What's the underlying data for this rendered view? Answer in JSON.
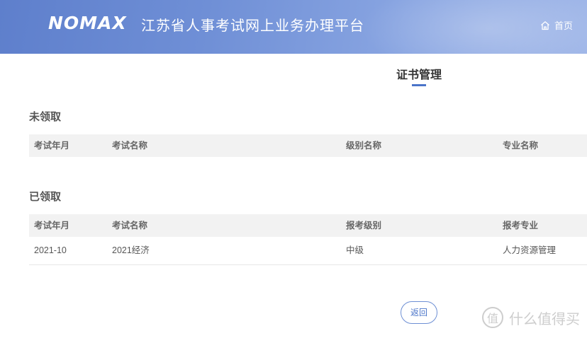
{
  "header": {
    "logo_text": "NOMAX",
    "platform_title": "江苏省人事考试网上业务办理平台",
    "home_label": "首页"
  },
  "page_title": "证书管理",
  "unclaimed": {
    "section_title": "未领取",
    "columns": [
      "考试年月",
      "考试名称",
      "级别名称",
      "专业名称"
    ],
    "rows": []
  },
  "claimed": {
    "section_title": "已领取",
    "columns": [
      "考试年月",
      "考试名称",
      "报考级别",
      "报考专业"
    ],
    "rows": [
      [
        "2021-10",
        "2021经济",
        "中级",
        "人力资源管理"
      ]
    ]
  },
  "actions": {
    "back_label": "返回"
  },
  "watermark": {
    "icon_glyph": "值",
    "text": "什么值得买"
  },
  "colors": {
    "header_blue": "#6f8fd6",
    "accent": "#4a74c9"
  }
}
